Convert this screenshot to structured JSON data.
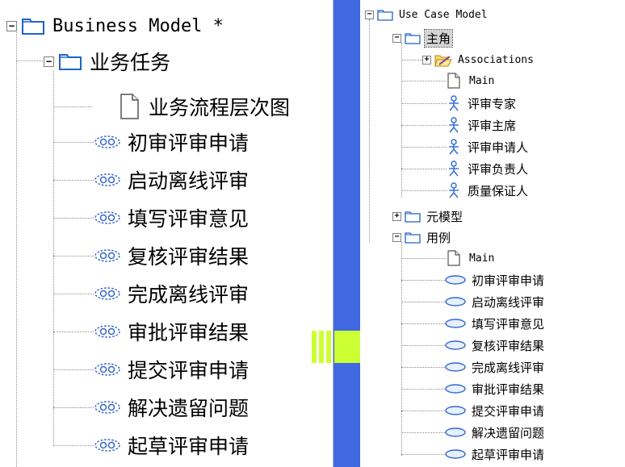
{
  "left_tree": {
    "root_label": "Business Model *",
    "child_label": "业务任务",
    "diagram_label": "业务流程层次图",
    "use_cases": [
      "初审评审申请",
      "启动离线评审",
      "填写评审意见",
      "复核评审结果",
      "完成离线评审",
      "审批评审结果",
      "提交评审申请",
      "解决遗留问题",
      "起草评审申请"
    ]
  },
  "right_tree": {
    "root_label": "Use Case Model",
    "actors_folder": {
      "label": "主角",
      "associations": "Associations",
      "main": "Main",
      "actors": [
        "评审专家",
        "评审主席",
        "评审申请人",
        "评审负责人",
        "质量保证人"
      ]
    },
    "meta_folder": "元模型",
    "usecase_folder": {
      "label": "用例",
      "main": "Main",
      "use_cases": [
        "初审评审申请",
        "启动离线评审",
        "填写评审意见",
        "复核评审结果",
        "完成离线评审",
        "审批评审结果",
        "提交评审申请",
        "解决遗留问题",
        "起草评审申请"
      ]
    }
  },
  "expander_glyphs": {
    "expanded": "−",
    "collapsed": "+"
  },
  "colors": {
    "background": "#4169e1",
    "arrow": "#ccff33",
    "folder_fill": "#ffffff",
    "folder_border": "#1e64c8",
    "usecase_fill": "#e6f0ff",
    "usecase_border": "#3366cc",
    "actor": "#2c6bd8"
  }
}
